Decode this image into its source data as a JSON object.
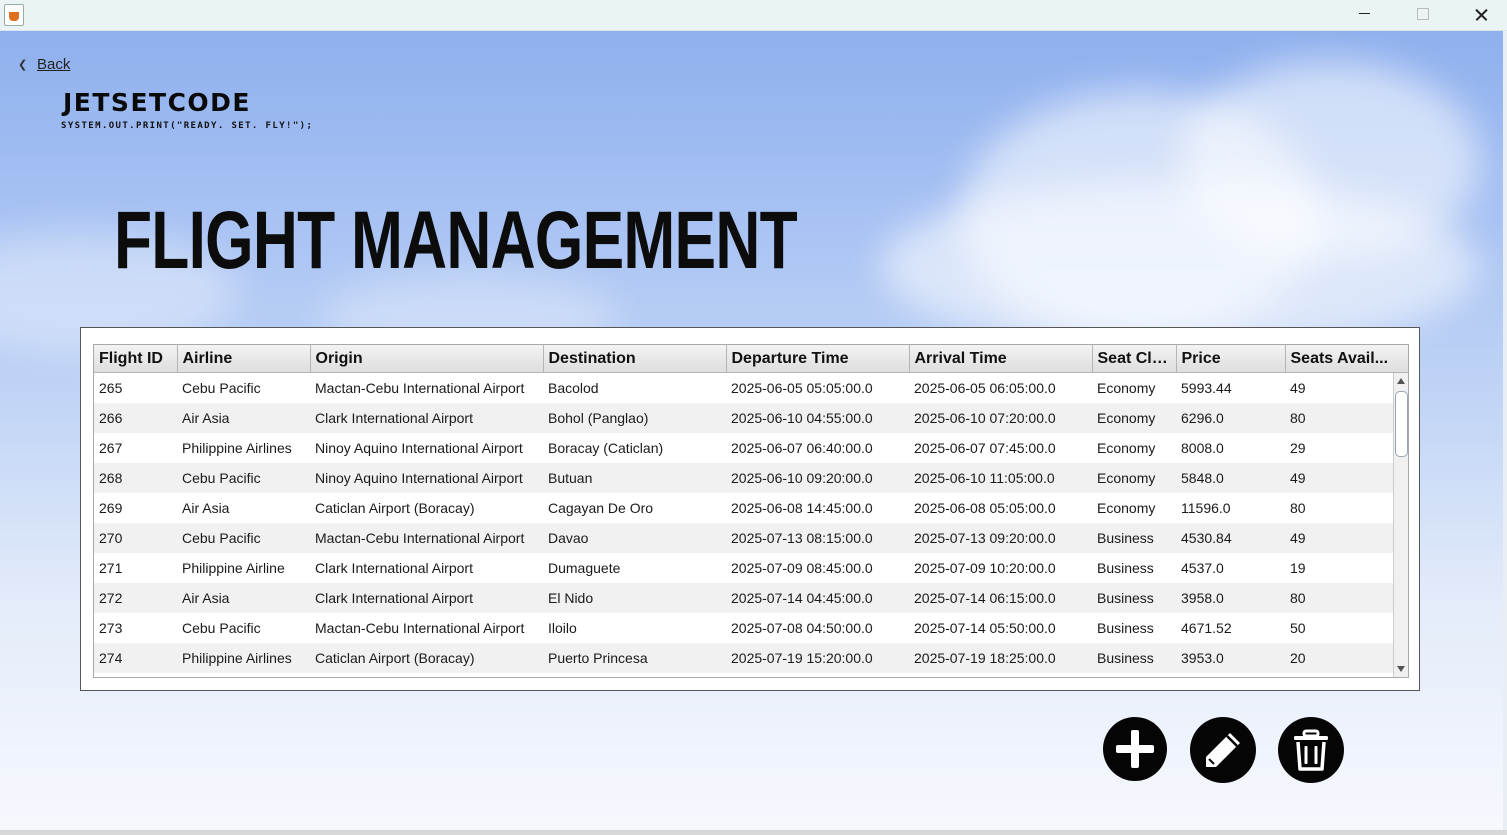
{
  "window": {
    "icons": [
      "java-icon",
      "minimize-icon",
      "maximize-icon",
      "close-icon"
    ]
  },
  "nav": {
    "back_label": "Back"
  },
  "brand": {
    "name": "JETSETCODE",
    "tagline": "SYSTEM.OUT.PRINT(\"READY. SET. FLY!\");"
  },
  "page": {
    "title": "FLIGHT MANAGEMENT"
  },
  "table": {
    "columns": [
      "Flight ID",
      "Airline",
      "Origin",
      "Destination",
      "Departure Time",
      "Arrival Time",
      "Seat Cla...",
      "Price",
      "Seats Avail..."
    ],
    "rows": [
      [
        "265",
        "Cebu Pacific",
        "Mactan-Cebu International Airport",
        "Bacolod",
        "2025-06-05 05:05:00.0",
        "2025-06-05 06:05:00.0",
        "Economy",
        "5993.44",
        "49"
      ],
      [
        "266",
        "Air Asia",
        "Clark International Airport",
        "Bohol (Panglao)",
        "2025-06-10 04:55:00.0",
        "2025-06-10 07:20:00.0",
        "Economy",
        "6296.0",
        "80"
      ],
      [
        "267",
        "Philippine Airlines",
        "Ninoy Aquino International Airport",
        "Boracay (Caticlan)",
        "2025-06-07 06:40:00.0",
        "2025-06-07 07:45:00.0",
        "Economy",
        "8008.0",
        "29"
      ],
      [
        "268",
        "Cebu Pacific",
        "Ninoy Aquino International Airport",
        "Butuan",
        "2025-06-10 09:20:00.0",
        "2025-06-10 11:05:00.0",
        "Economy",
        "5848.0",
        "49"
      ],
      [
        "269",
        "Air Asia",
        "Caticlan Airport (Boracay)",
        "Cagayan De Oro",
        "2025-06-08 14:45:00.0",
        "2025-06-08 05:05:00.0",
        "Economy",
        "11596.0",
        "80"
      ],
      [
        "270",
        "Cebu Pacific",
        "Mactan-Cebu International Airport",
        "Davao",
        "2025-07-13 08:15:00.0",
        "2025-07-13 09:20:00.0",
        "Business",
        "4530.84",
        "49"
      ],
      [
        "271",
        "Philippine Airline",
        "Clark International Airport",
        "Dumaguete",
        "2025-07-09 08:45:00.0",
        "2025-07-09 10:20:00.0",
        "Business",
        "4537.0",
        "19"
      ],
      [
        "272",
        "Air Asia",
        "Clark International Airport",
        "El Nido",
        "2025-07-14 04:45:00.0",
        "2025-07-14 06:15:00.0",
        "Business",
        "3958.0",
        "80"
      ],
      [
        "273",
        "Cebu Pacific",
        "Mactan-Cebu International Airport",
        "Iloilo",
        "2025-07-08 04:50:00.0",
        "2025-07-14 05:50:00.0",
        "Business",
        "4671.52",
        "50"
      ],
      [
        "274",
        "Philippine Airlines",
        "Caticlan Airport (Boracay)",
        "Puerto Princesa",
        "2025-07-19 15:20:00.0",
        "2025-07-19 18:25:00.0",
        "Business",
        "3953.0",
        "20"
      ]
    ]
  },
  "actions": {
    "icons": [
      "add-icon",
      "edit-icon",
      "delete-icon"
    ]
  }
}
